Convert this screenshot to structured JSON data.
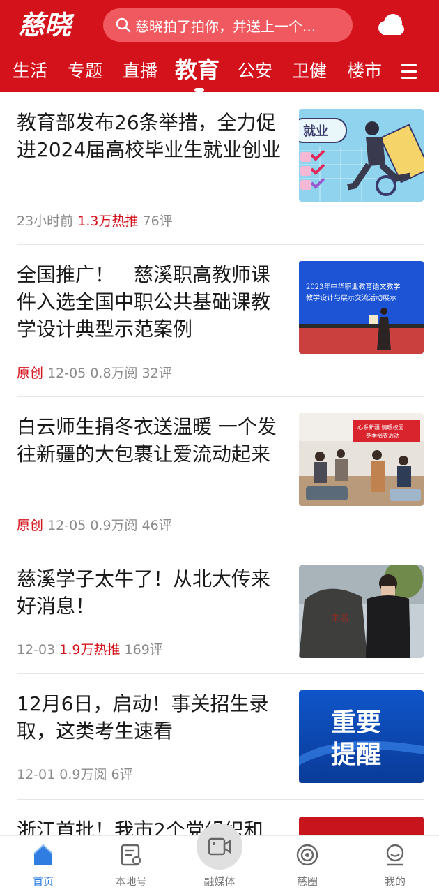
{
  "header": {
    "logo_text": "慈晓",
    "search_placeholder": "慈晓拍了拍你，并送上一个...",
    "weather_icon": "cloud-icon",
    "tabs": [
      "生活",
      "专题",
      "直播",
      "教育",
      "公安",
      "卫健",
      "楼市"
    ],
    "active_tab": "教育",
    "menu_icon": "hamburger-menu-icon"
  },
  "feed": [
    {
      "title": "教育部发布26条举措，全力促进2024届高校毕业生就业创业",
      "time": "23小时前",
      "stat": "1.3万热推",
      "stat_red": true,
      "comments": "76评",
      "tag": ""
    },
    {
      "title": "全国推广！　慈溪职高教师课件入选全国中职公共基础课教学设计典型示范案例",
      "time": "12-05",
      "stat": "0.8万阅",
      "stat_red": false,
      "comments": "32评",
      "tag": "原创"
    },
    {
      "title": "白云师生捐冬衣送温暖 一个发往新疆的大包裹让爱流动起来",
      "time": "12-05",
      "stat": "0.9万阅",
      "stat_red": false,
      "comments": "46评",
      "tag": "原创"
    },
    {
      "title": "慈溪学子太牛了！从北大传来好消息！",
      "time": "12-03",
      "stat": "1.9万热推",
      "stat_red": true,
      "comments": "169评",
      "tag": ""
    },
    {
      "title": "12月6日，启动！事关招生录取，这类考生速看",
      "time": "12-01",
      "stat": "0.9万阅",
      "stat_red": false,
      "comments": "6评",
      "tag": ""
    },
    {
      "title": "浙江首批！我市2个党组织和",
      "time": "",
      "stat": "",
      "stat_red": false,
      "comments": "",
      "tag": ""
    }
  ],
  "thumb_text": {
    "employment_banner": "就业",
    "stage_banner_line1": "2023年中华职业教育语文教学",
    "stage_banner_line2": "教学设计与展示交流活动展示",
    "donation_banner_line1": "心系新疆 情暖校园",
    "donation_banner_line2": "冬季捐衣活动",
    "stone_inscription": "未名",
    "reminder_line1": "重要",
    "reminder_line2": "提醒"
  },
  "tabbar": {
    "items": [
      {
        "label": "首页",
        "icon": "home-icon",
        "active": true
      },
      {
        "label": "本地号",
        "icon": "local-account-icon",
        "active": false
      },
      {
        "label": "融媒体",
        "icon": "video-camera-icon",
        "active": false
      },
      {
        "label": "慈圈",
        "icon": "circle-community-icon",
        "active": false
      },
      {
        "label": "我的",
        "icon": "profile-icon",
        "active": false
      }
    ]
  },
  "colors": {
    "brand_red": "#d4121b",
    "active_blue": "#2f7de1",
    "meta_gray": "#8b8b8b"
  }
}
